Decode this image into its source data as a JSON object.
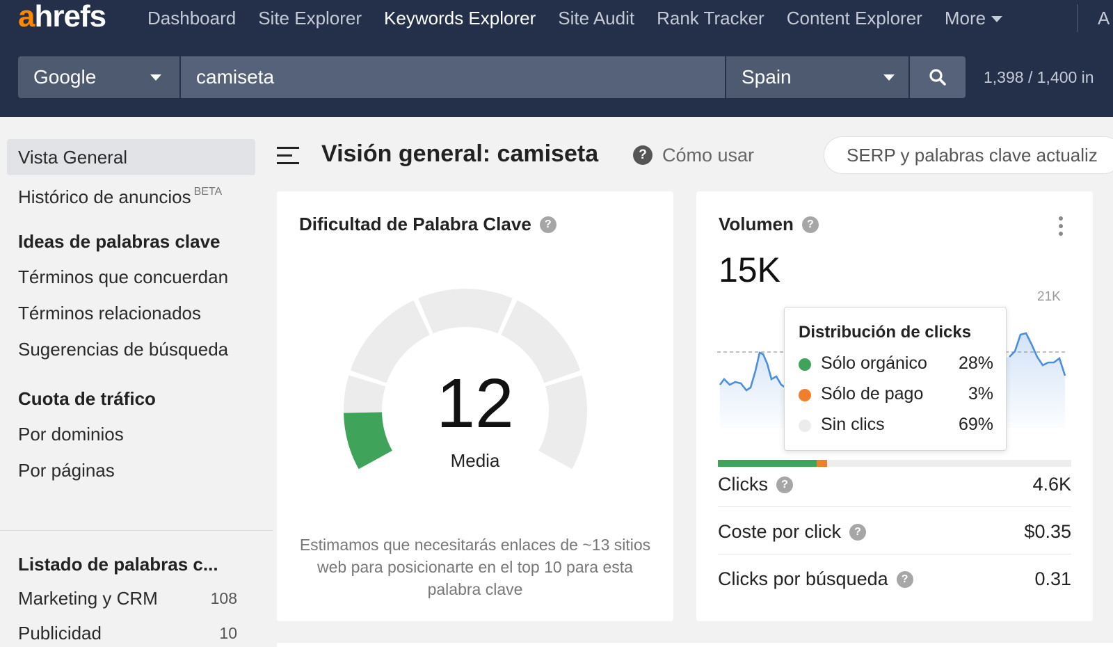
{
  "header": {
    "logo_first": "a",
    "logo_rest": "hrefs",
    "nav": [
      {
        "label": "Dashboard",
        "active": false
      },
      {
        "label": "Site Explorer",
        "active": false
      },
      {
        "label": "Keywords Explorer",
        "active": true
      },
      {
        "label": "Site Audit",
        "active": false
      },
      {
        "label": "Rank Tracker",
        "active": false
      },
      {
        "label": "Content Explorer",
        "active": false
      },
      {
        "label": "More",
        "active": false
      }
    ],
    "nav_extra": "A",
    "search": {
      "engine": "Google",
      "keyword": "camiseta",
      "country": "Spain",
      "quota": "1,398 / 1,400 in"
    }
  },
  "sidebar": {
    "overview": "Vista General",
    "ads_history": "Histórico de anuncios",
    "ads_badge": "BETA",
    "ideas_heading": "Ideas de palabras clave",
    "ideas": [
      "Términos que concuerdan",
      "Términos relacionados",
      "Sugerencias de búsqueda"
    ],
    "traffic_heading": "Cuota de tráfico",
    "traffic": [
      "Por dominios",
      "Por páginas"
    ],
    "lists_heading": "Listado de palabras c...",
    "lists": [
      {
        "label": "Marketing y CRM",
        "count": "108"
      },
      {
        "label": "Publicidad",
        "count": "10"
      }
    ]
  },
  "main": {
    "title": "Visión general: camiseta",
    "howto": "Cómo usar",
    "help_glyph": "?",
    "serp_status": "SERP y palabras clave actualiz"
  },
  "kd_card": {
    "title": "Dificultad de Palabra Clave",
    "value": "12",
    "value_fraction": 0.12,
    "label": "Media",
    "note": "Estimamos que necesitarás enlaces de ~13 sitios web para posicionarte en el top 10 para esta palabra clave",
    "colors": {
      "fill": "#3fa35a",
      "track": "#ececec"
    }
  },
  "volume_card": {
    "title": "Volumen",
    "value": "15K",
    "chart_max_label": "21K",
    "tooltip": {
      "title": "Distribución de clicks",
      "rows": [
        {
          "label": "Sólo orgánico",
          "pct": "28%",
          "color": "#3fa35a"
        },
        {
          "label": "Sólo de pago",
          "pct": "3%",
          "color": "#f07f2c"
        },
        {
          "label": "Sin clics",
          "pct": "69%",
          "color": "#ececec"
        }
      ]
    },
    "metrics": [
      {
        "label": "Clicks",
        "value": "4.6K"
      },
      {
        "label": "Coste por click",
        "value": "$0.35"
      },
      {
        "label": "Clicks por búsqueda",
        "value": "0.31"
      }
    ],
    "colors": {
      "line": "#4a8ee0"
    }
  }
}
